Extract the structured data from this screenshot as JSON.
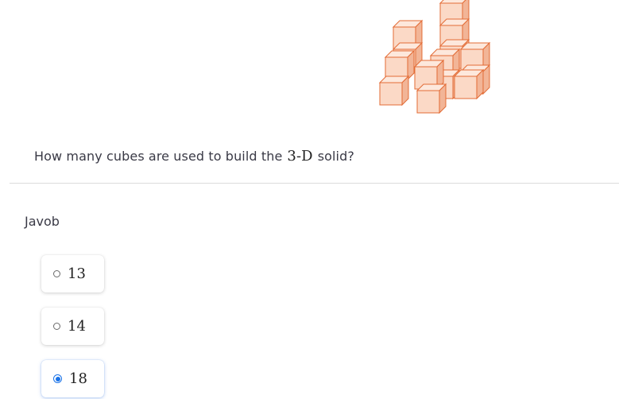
{
  "question": {
    "prefix": "How many cubes are used to build the",
    "math": "3-D",
    "suffix": "solid?"
  },
  "answer_label": "Javob",
  "options": [
    {
      "label": "13",
      "selected": false
    },
    {
      "label": "14",
      "selected": false
    },
    {
      "label": "18",
      "selected": true
    }
  ],
  "colors": {
    "cube_front": "#fbd9c6",
    "cube_top": "#fde8dc",
    "cube_side": "#f2b597",
    "cube_edge": "#e36c36",
    "accent": "#1a73e8"
  },
  "figure": {
    "icon": "cube-stack-figure"
  }
}
